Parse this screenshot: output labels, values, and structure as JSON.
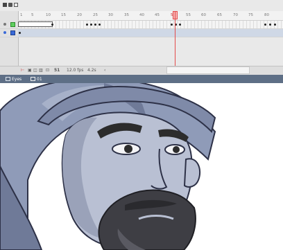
{
  "timeline": {
    "ruler_ticks": [
      "1",
      "5",
      "10",
      "15",
      "20",
      "25",
      "30",
      "35",
      "40",
      "45",
      "50",
      "55",
      "60",
      "65",
      "70",
      "75",
      "80"
    ],
    "layers": [
      {
        "id": 1,
        "selected": false
      },
      {
        "id": 2,
        "selected": true
      }
    ],
    "playhead_frame": "51",
    "status": {
      "current_frame": "51",
      "frame_rate": "12.0 fps",
      "elapsed_time": "4.2s"
    }
  },
  "breadcrumb": {
    "scene_label": "Eyes",
    "symbol_label": "01"
  },
  "stage": {
    "image": "cartoon-man-with-turban-and-beard"
  },
  "colors": {
    "turban": "#8f9bb8",
    "turban_shadow": "#6f7a98",
    "skin": "#b9c0d3",
    "skin_shadow": "#9aa2b9",
    "beard": "#3e3e44",
    "brow": "#2c2c2c",
    "playhead": "#e34a4a",
    "breadcrumb_bg": "#5e6f86"
  }
}
